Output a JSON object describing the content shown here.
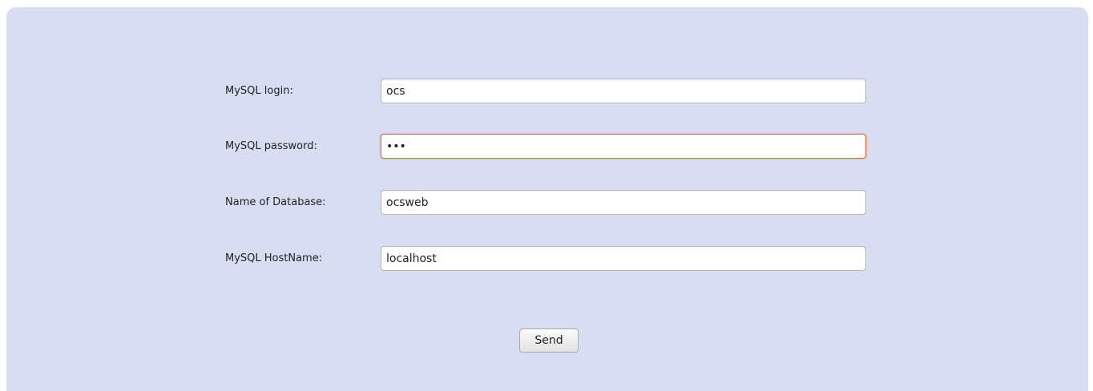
{
  "form": {
    "fields": [
      {
        "label": "MySQL login:",
        "value": "ocs",
        "type": "text"
      },
      {
        "label": "MySQL password:",
        "value": "ocs",
        "type": "password",
        "focused": true
      },
      {
        "label": "Name of Database:",
        "value": "ocsweb",
        "type": "text"
      },
      {
        "label": "MySQL HostName:",
        "value": "localhost",
        "type": "text"
      }
    ],
    "send_label": "Send"
  },
  "colors": {
    "panel_background": "#d8ddf2",
    "focus_border": "#e06a3c"
  }
}
